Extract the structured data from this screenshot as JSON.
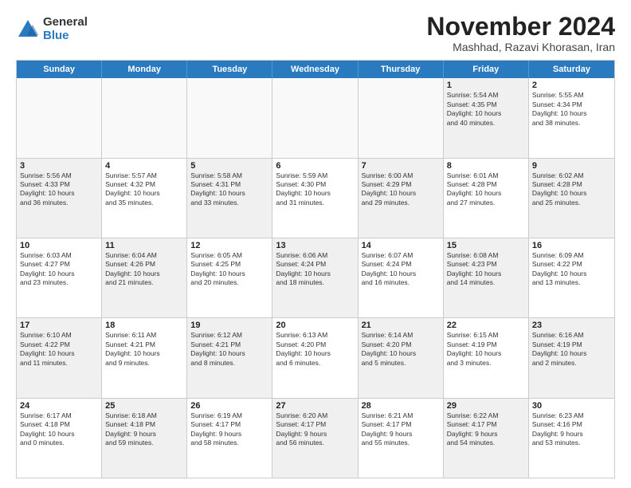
{
  "header": {
    "logo_general": "General",
    "logo_blue": "Blue",
    "month_title": "November 2024",
    "location": "Mashhad, Razavi Khorasan, Iran"
  },
  "calendar": {
    "days_of_week": [
      "Sunday",
      "Monday",
      "Tuesday",
      "Wednesday",
      "Thursday",
      "Friday",
      "Saturday"
    ],
    "rows": [
      [
        {
          "day": "",
          "info": "",
          "empty": true
        },
        {
          "day": "",
          "info": "",
          "empty": true
        },
        {
          "day": "",
          "info": "",
          "empty": true
        },
        {
          "day": "",
          "info": "",
          "empty": true
        },
        {
          "day": "",
          "info": "",
          "empty": true
        },
        {
          "day": "1",
          "info": "Sunrise: 5:54 AM\nSunset: 4:35 PM\nDaylight: 10 hours\nand 40 minutes.",
          "shaded": true
        },
        {
          "day": "2",
          "info": "Sunrise: 5:55 AM\nSunset: 4:34 PM\nDaylight: 10 hours\nand 38 minutes.",
          "shaded": false
        }
      ],
      [
        {
          "day": "3",
          "info": "Sunrise: 5:56 AM\nSunset: 4:33 PM\nDaylight: 10 hours\nand 36 minutes.",
          "shaded": true
        },
        {
          "day": "4",
          "info": "Sunrise: 5:57 AM\nSunset: 4:32 PM\nDaylight: 10 hours\nand 35 minutes.",
          "shaded": false
        },
        {
          "day": "5",
          "info": "Sunrise: 5:58 AM\nSunset: 4:31 PM\nDaylight: 10 hours\nand 33 minutes.",
          "shaded": true
        },
        {
          "day": "6",
          "info": "Sunrise: 5:59 AM\nSunset: 4:30 PM\nDaylight: 10 hours\nand 31 minutes.",
          "shaded": false
        },
        {
          "day": "7",
          "info": "Sunrise: 6:00 AM\nSunset: 4:29 PM\nDaylight: 10 hours\nand 29 minutes.",
          "shaded": true
        },
        {
          "day": "8",
          "info": "Sunrise: 6:01 AM\nSunset: 4:28 PM\nDaylight: 10 hours\nand 27 minutes.",
          "shaded": false
        },
        {
          "day": "9",
          "info": "Sunrise: 6:02 AM\nSunset: 4:28 PM\nDaylight: 10 hours\nand 25 minutes.",
          "shaded": true
        }
      ],
      [
        {
          "day": "10",
          "info": "Sunrise: 6:03 AM\nSunset: 4:27 PM\nDaylight: 10 hours\nand 23 minutes.",
          "shaded": false
        },
        {
          "day": "11",
          "info": "Sunrise: 6:04 AM\nSunset: 4:26 PM\nDaylight: 10 hours\nand 21 minutes.",
          "shaded": true
        },
        {
          "day": "12",
          "info": "Sunrise: 6:05 AM\nSunset: 4:25 PM\nDaylight: 10 hours\nand 20 minutes.",
          "shaded": false
        },
        {
          "day": "13",
          "info": "Sunrise: 6:06 AM\nSunset: 4:24 PM\nDaylight: 10 hours\nand 18 minutes.",
          "shaded": true
        },
        {
          "day": "14",
          "info": "Sunrise: 6:07 AM\nSunset: 4:24 PM\nDaylight: 10 hours\nand 16 minutes.",
          "shaded": false
        },
        {
          "day": "15",
          "info": "Sunrise: 6:08 AM\nSunset: 4:23 PM\nDaylight: 10 hours\nand 14 minutes.",
          "shaded": true
        },
        {
          "day": "16",
          "info": "Sunrise: 6:09 AM\nSunset: 4:22 PM\nDaylight: 10 hours\nand 13 minutes.",
          "shaded": false
        }
      ],
      [
        {
          "day": "17",
          "info": "Sunrise: 6:10 AM\nSunset: 4:22 PM\nDaylight: 10 hours\nand 11 minutes.",
          "shaded": true
        },
        {
          "day": "18",
          "info": "Sunrise: 6:11 AM\nSunset: 4:21 PM\nDaylight: 10 hours\nand 9 minutes.",
          "shaded": false
        },
        {
          "day": "19",
          "info": "Sunrise: 6:12 AM\nSunset: 4:21 PM\nDaylight: 10 hours\nand 8 minutes.",
          "shaded": true
        },
        {
          "day": "20",
          "info": "Sunrise: 6:13 AM\nSunset: 4:20 PM\nDaylight: 10 hours\nand 6 minutes.",
          "shaded": false
        },
        {
          "day": "21",
          "info": "Sunrise: 6:14 AM\nSunset: 4:20 PM\nDaylight: 10 hours\nand 5 minutes.",
          "shaded": true
        },
        {
          "day": "22",
          "info": "Sunrise: 6:15 AM\nSunset: 4:19 PM\nDaylight: 10 hours\nand 3 minutes.",
          "shaded": false
        },
        {
          "day": "23",
          "info": "Sunrise: 6:16 AM\nSunset: 4:19 PM\nDaylight: 10 hours\nand 2 minutes.",
          "shaded": true
        }
      ],
      [
        {
          "day": "24",
          "info": "Sunrise: 6:17 AM\nSunset: 4:18 PM\nDaylight: 10 hours\nand 0 minutes.",
          "shaded": false
        },
        {
          "day": "25",
          "info": "Sunrise: 6:18 AM\nSunset: 4:18 PM\nDaylight: 9 hours\nand 59 minutes.",
          "shaded": true
        },
        {
          "day": "26",
          "info": "Sunrise: 6:19 AM\nSunset: 4:17 PM\nDaylight: 9 hours\nand 58 minutes.",
          "shaded": false
        },
        {
          "day": "27",
          "info": "Sunrise: 6:20 AM\nSunset: 4:17 PM\nDaylight: 9 hours\nand 56 minutes.",
          "shaded": true
        },
        {
          "day": "28",
          "info": "Sunrise: 6:21 AM\nSunset: 4:17 PM\nDaylight: 9 hours\nand 55 minutes.",
          "shaded": false
        },
        {
          "day": "29",
          "info": "Sunrise: 6:22 AM\nSunset: 4:17 PM\nDaylight: 9 hours\nand 54 minutes.",
          "shaded": true
        },
        {
          "day": "30",
          "info": "Sunrise: 6:23 AM\nSunset: 4:16 PM\nDaylight: 9 hours\nand 53 minutes.",
          "shaded": false
        }
      ]
    ]
  }
}
